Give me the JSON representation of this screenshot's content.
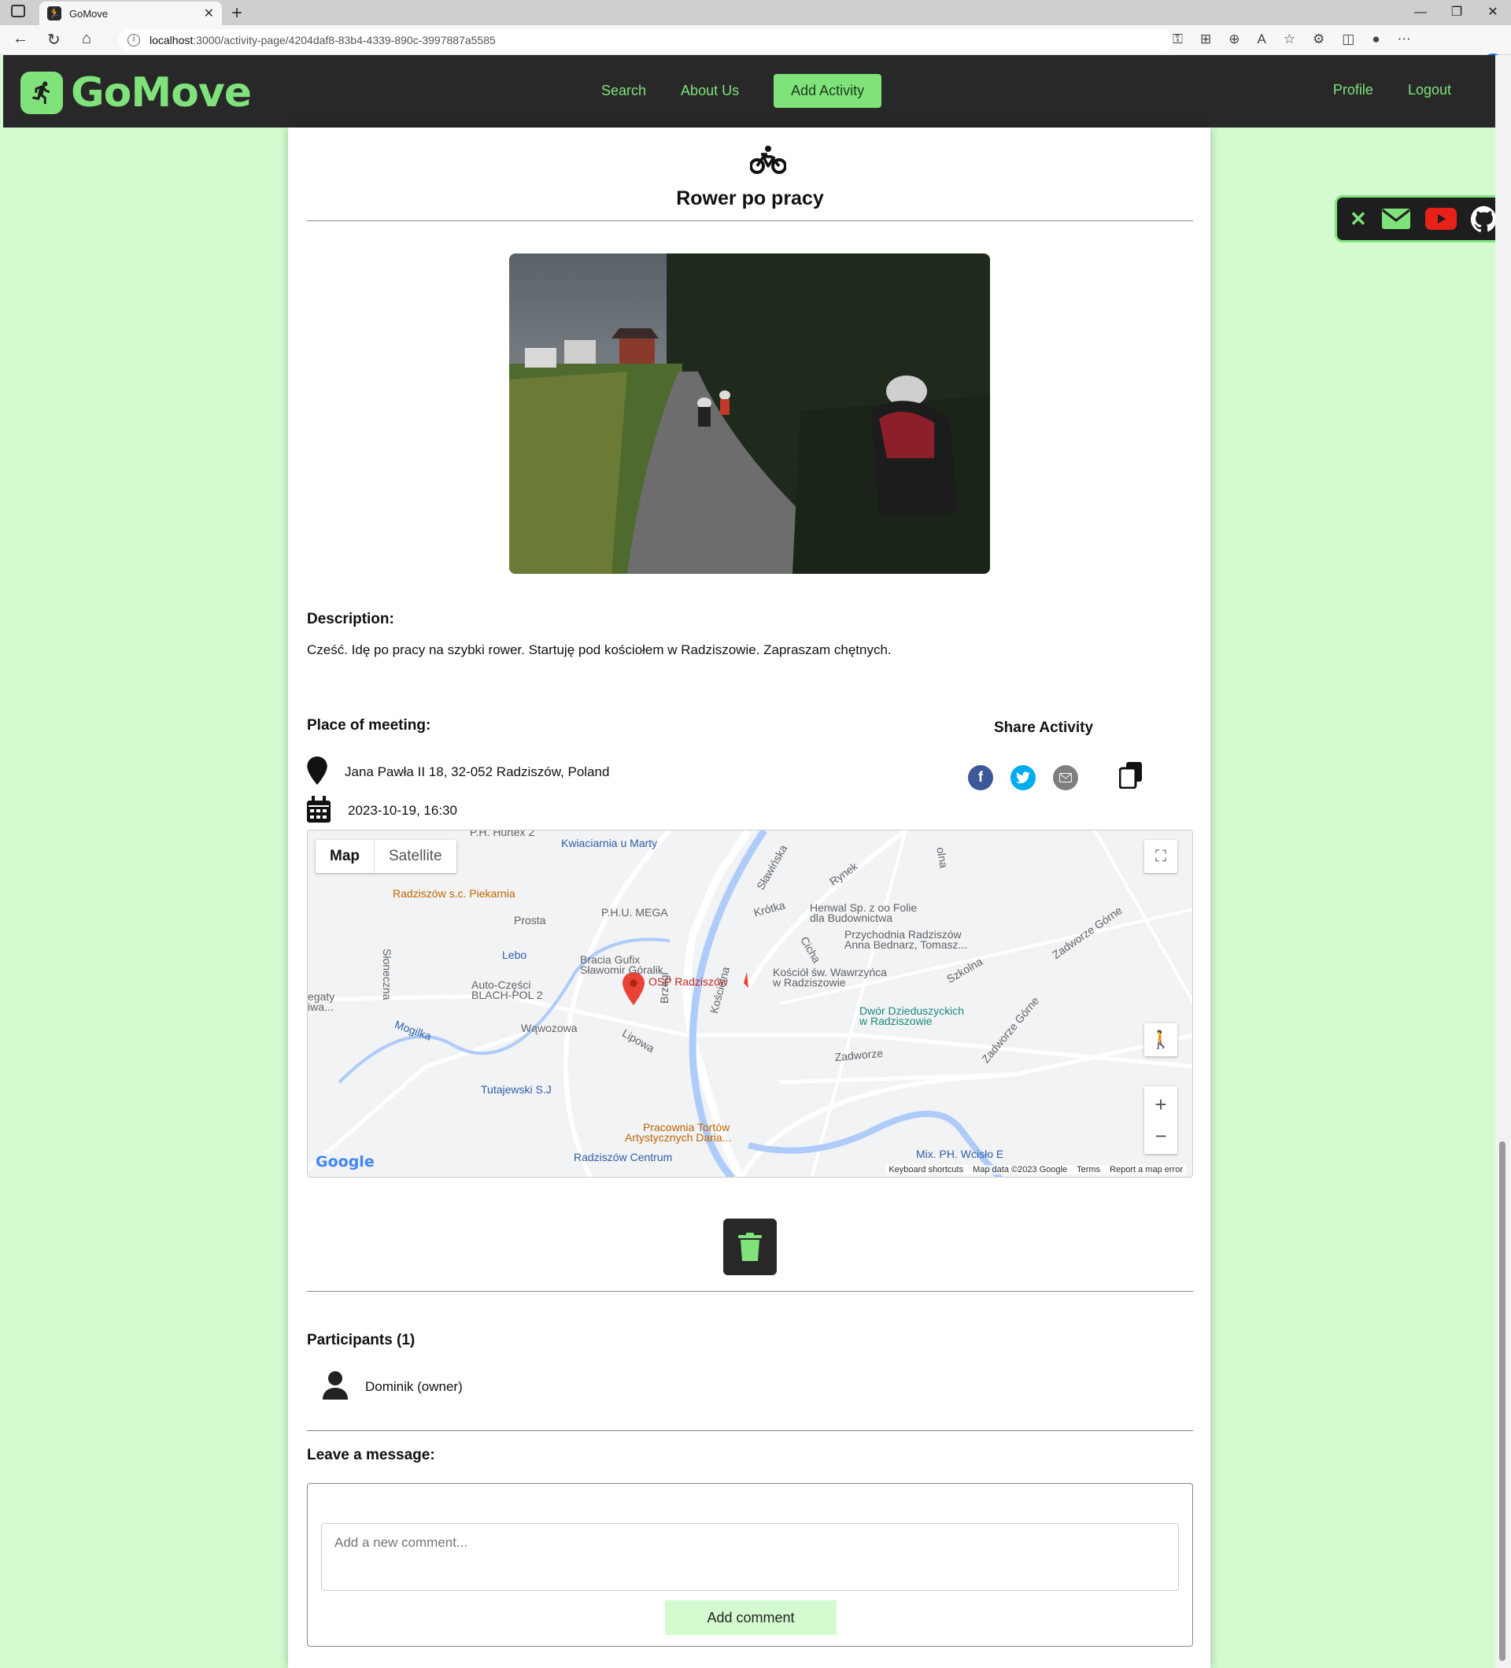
{
  "browser": {
    "tab_title": "GoMove",
    "url_host": "localhost",
    "url_path": ":3000/activity-page/4204daf8-83b4-4339-890c-3997887a5585"
  },
  "header": {
    "logo_text": "GoMove",
    "nav": {
      "search": "Search",
      "about": "About Us",
      "add_activity": "Add Activity",
      "profile": "Profile",
      "logout": "Logout"
    }
  },
  "activity": {
    "title": "Rower po pracy",
    "description_heading": "Description:",
    "description": "Cześć. Idę po pracy na szybki rower. Startuję pod kościołem w Radziszowie. Zapraszam chętnych.",
    "place_heading": "Place of meeting:",
    "address": "Jana Pawła II 18, 32-052 Radziszów, Poland",
    "datetime": "2023-10-19, 16:30",
    "share_heading": "Share Activity"
  },
  "map": {
    "type_map": "Map",
    "type_satellite": "Satellite",
    "attribution": {
      "shortcuts": "Keyboard shortcuts",
      "data": "Map data ©2023 Google",
      "terms": "Terms",
      "report": "Report a map error"
    },
    "labels": [
      "Kwiaciarnia u Marty",
      "Radziszów s.c. Piekarnia",
      "Prosta",
      "P.H.U. MEGA",
      "Krótka",
      "Henwal Sp. z oo Folie",
      "dla Budownictwa",
      "Przychodnia Radziszów",
      "Anna Bednarz, Tomasz...",
      "Lebo",
      "Bracia Gufix",
      "Sławomir Góralik",
      "OSP Radziszów",
      "Kościół św. Wawrzyńca",
      "w Radziszowie",
      "Auto-Części",
      "BLACH-POL 2",
      "Dwór Dzieduszyckich",
      "w Radziszowie",
      "Mogilka",
      "Wąwozowa",
      "Lipowa",
      "Brzegi",
      "Kościelna",
      "Zadworze",
      "Zadworze Górne",
      "Zadworze Górne",
      "Szkolna",
      "Tutajewski S.J",
      "Pracownia Tortów",
      "Artystycznych Daria...",
      "Radziszów Centrum",
      "Mix. PH. Wcisło E",
      "Sławińska",
      "Rynek",
      "Słoneczna",
      "Cicha",
      "egaty",
      "iwa...",
      "P.H. Hurtex 2",
      "olna"
    ]
  },
  "participants": {
    "heading": "Participants (1)",
    "list": [
      "Dominik (owner)"
    ]
  },
  "comments": {
    "heading": "Leave a message:",
    "placeholder": "Add a new comment...",
    "button": "Add comment"
  },
  "colors": {
    "accent": "#7fe27a",
    "page_bg": "#d4fbd0",
    "header_bg": "#282828"
  }
}
